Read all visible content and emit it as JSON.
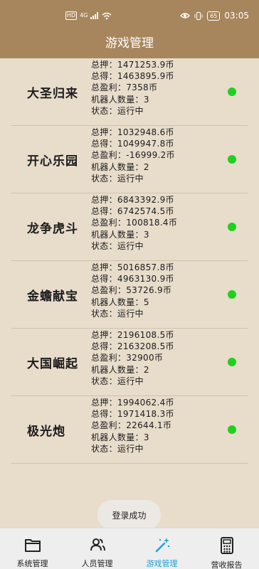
{
  "status_bar": {
    "hd": "HD",
    "signal": "4G",
    "battery": "65",
    "time": "03:05"
  },
  "title": "游戏管理",
  "labels": {
    "total_bet": "总押：",
    "total_win": "总得：",
    "total_profit": "总盈利：",
    "robots": "机器人数量：",
    "status": "状态：",
    "currency": "币"
  },
  "games": [
    {
      "name": "大圣归来",
      "total_bet": "1471253.9币",
      "total_win": "1463895.9币",
      "total_profit": "7358币",
      "robots": "3",
      "status": "运行中",
      "status_color": "#1ed11e"
    },
    {
      "name": "开心乐园",
      "total_bet": "1032948.6币",
      "total_win": "1049947.8币",
      "total_profit": "-16999.2币",
      "robots": "2",
      "status": "运行中",
      "status_color": "#1ed11e"
    },
    {
      "name": "龙争虎斗",
      "total_bet": "6843392.9币",
      "total_win": "6742574.5币",
      "total_profit": "100818.4币",
      "robots": "3",
      "status": "运行中",
      "status_color": "#1ed11e"
    },
    {
      "name": "金蟾献宝",
      "total_bet": "5016857.8币",
      "total_win": "4963130.9币",
      "total_profit": "53726.9币",
      "robots": "5",
      "status": "运行中",
      "status_color": "#1ed11e"
    },
    {
      "name": "大国崛起",
      "total_bet": "2196108.5币",
      "total_win": "2163208.5币",
      "total_profit": "32900币",
      "robots": "2",
      "status": "运行中",
      "status_color": "#1ed11e"
    },
    {
      "name": "极光炮",
      "total_bet": "1994062.4币",
      "total_win": "1971418.3币",
      "total_profit": "22644.1币",
      "robots": "3",
      "status": "运行中",
      "status_color": "#1ed11e"
    }
  ],
  "toast": "登录成功",
  "nav": [
    {
      "label": "系统管理",
      "icon": "folder-icon",
      "active": false
    },
    {
      "label": "人员管理",
      "icon": "users-icon",
      "active": false
    },
    {
      "label": "游戏管理",
      "icon": "magic-wand-icon",
      "active": true
    },
    {
      "label": "营收报告",
      "icon": "calculator-icon",
      "active": false
    }
  ],
  "colors": {
    "header": "#a8865d",
    "background": "#e8dccb",
    "active": "#1aa3d9",
    "status_ok": "#1ed11e"
  }
}
